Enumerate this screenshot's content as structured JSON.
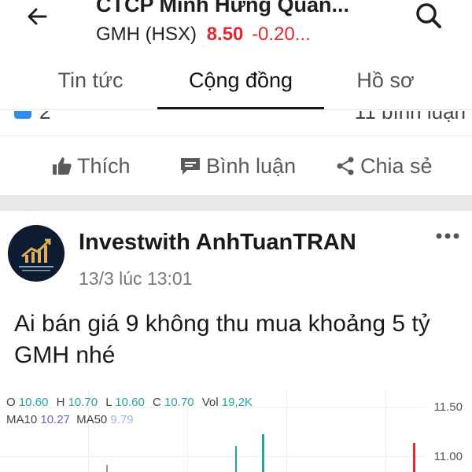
{
  "header": {
    "title": "CTCP Minh Hưng Quản...",
    "ticker": "GMH (HSX)",
    "price": "8.50",
    "change": "-0.20..."
  },
  "tabs": [
    {
      "label": "Tin tức",
      "active": false
    },
    {
      "label": "Cộng đồng",
      "active": true
    },
    {
      "label": "Hồ sơ",
      "active": false
    }
  ],
  "prev_post": {
    "like_count": "2",
    "comment_count": "11 bình luận"
  },
  "actions": {
    "like_label": "Thích",
    "comment_label": "Bình luận",
    "share_label": "Chia sẻ"
  },
  "post": {
    "author": "Investwith AnhTuanTRAN",
    "time": "13/3 lúc 13:01",
    "body": "Ai bán giá 9 không thu mua khoảng 5 tỷ GMH nhé"
  },
  "chart": {
    "o_label": "O",
    "o_value": "10.60",
    "h_label": "H",
    "h_value": "10.70",
    "l_label": "L",
    "l_value": "10.60",
    "c_label": "C",
    "c_value": "10.70",
    "vol_label": "Vol",
    "vol_value": "19,2K",
    "ma10_label": "MA10",
    "ma10_value": "10.27",
    "ma50_label": "MA50",
    "ma50_value": "9.79",
    "y_ticks": [
      "11.50",
      "11.00"
    ]
  },
  "colors": {
    "down_red": "#e0282e",
    "up_green": "#26a69a",
    "like_blue": "#2e8de6"
  },
  "icons": [
    "back-arrow-icon",
    "search-icon",
    "thumbs-up-icon",
    "comment-icon",
    "share-icon",
    "more-icon"
  ]
}
